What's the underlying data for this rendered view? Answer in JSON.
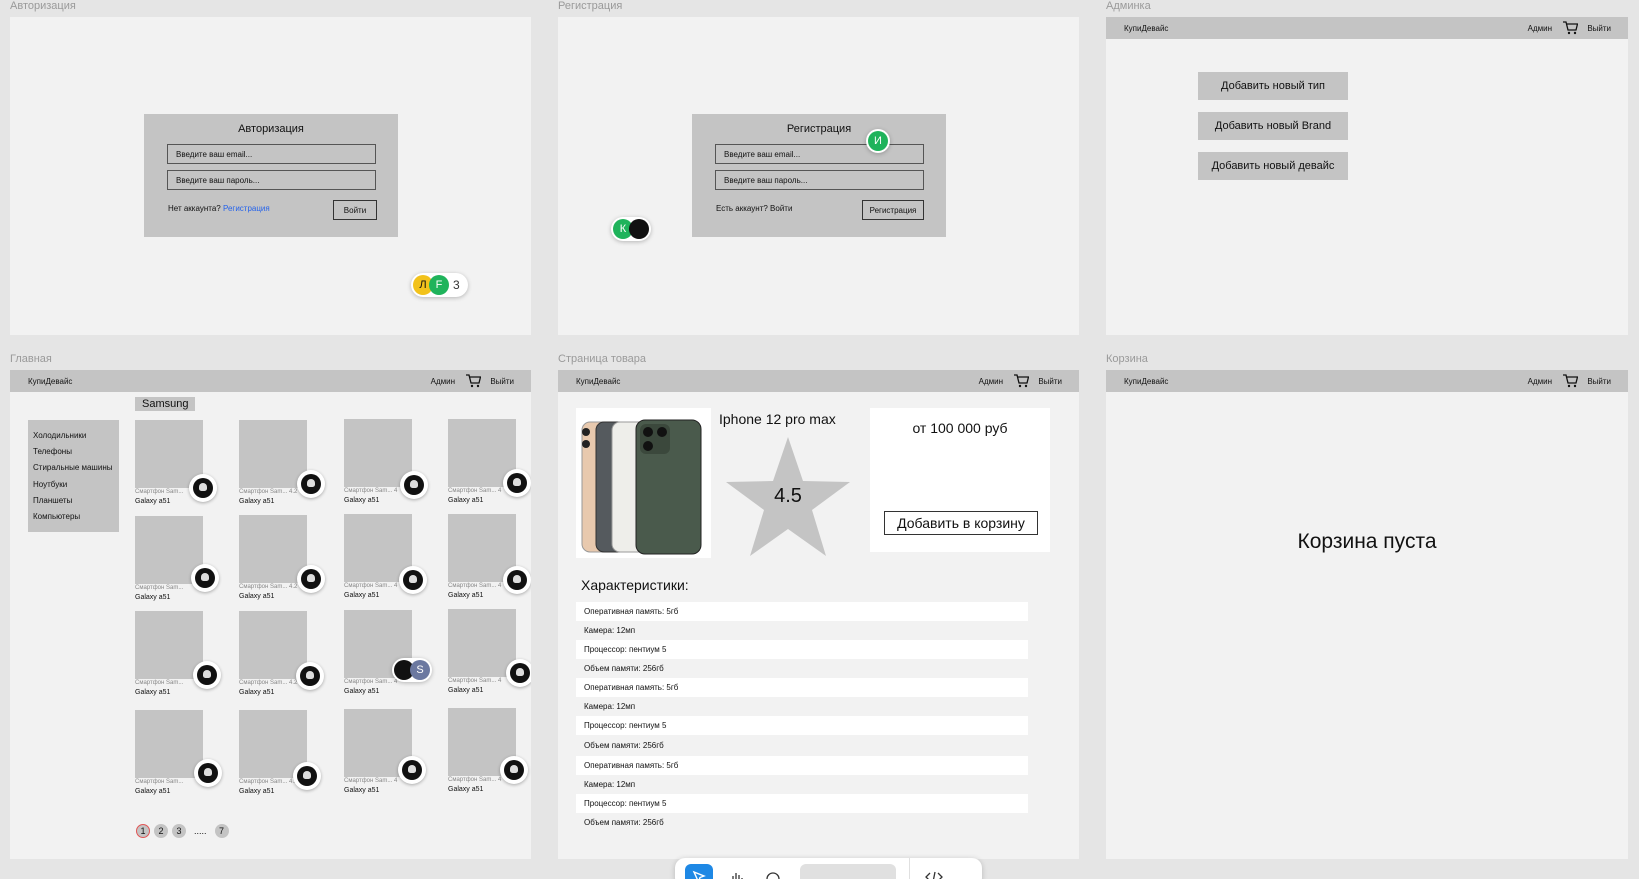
{
  "frames": {
    "auth": {
      "label": "Авторизация",
      "title": "Авторизация",
      "email_placeholder": "Введите ваш email...",
      "password_placeholder": "Введите ваш пароль...",
      "no_account": "Нет аккаунта?",
      "register_link": "Регистрация",
      "submit": "Войти",
      "presence": {
        "avatars": [
          "Л",
          "F"
        ],
        "count": "3"
      }
    },
    "register": {
      "label": "Регистрация",
      "title": "Регистрация",
      "email_placeholder": "Введите ваш email...",
      "password_placeholder": "Введите ваш пароль...",
      "have_account": "Есть аккаунт? Войти",
      "submit": "Регистрация",
      "cursor_avatar": "И",
      "presence_avatar": "К"
    },
    "admin": {
      "label": "Админка",
      "buttons": [
        "Добавить новый тип",
        "Добавить новый Brand",
        "Добавить новый девайс"
      ]
    },
    "main": {
      "label": "Главная",
      "categories": [
        "Холодильники",
        "Телефоны",
        "Стиральные машины",
        "Ноутбуки",
        "Планшеты",
        "Компьютеры"
      ],
      "brand_tag": "Samsung",
      "card_subtitles": [
        "Смартфон Sam...",
        "Смартфон Sam... 4.2",
        "Смартфон Sam... 4",
        "Смартфон Sam... 4"
      ],
      "card_name": "Galaxy a51",
      "pages": [
        "1",
        "2",
        "3",
        ".....",
        "7"
      ],
      "presence_avatar": "S"
    },
    "product": {
      "label": "Страница товара",
      "name": "Iphone 12 pro max",
      "rating": "4.5",
      "price": "от 100 000 руб",
      "add_to_cart": "Добавить в корзину",
      "specs_title": "Характеристики:",
      "specs": [
        "Оперативная память: 5гб",
        "Камера: 12мп",
        "Процессор: пентиум 5",
        "Объем памяти: 256гб",
        "Оперативная память: 5гб",
        "Камера: 12мп",
        "Процессор: пентиум 5",
        "Объем памяти: 256гб",
        "Оперативная память: 5гб",
        "Камера: 12мп",
        "Процессор: пентиум 5",
        "Объем памяти: 256гб"
      ]
    },
    "cart": {
      "label": "Корзина",
      "empty_text": "Корзина пуста"
    }
  },
  "navbar": {
    "brand": "КупиДевайс",
    "admin": "Админ",
    "logout": "Выйти"
  },
  "colors": {
    "canvas": "#e5e5e5",
    "frame": "#f2f2f2",
    "block_gray": "#c4c4c4",
    "link_blue": "#2563eb",
    "presence_green": "#1fb35b",
    "presence_yellow": "#f2c21b",
    "toolbar_accent": "#1e88e5"
  },
  "icons": [
    "cart-icon",
    "star-icon",
    "skull-avatar-icon",
    "cursor-icon",
    "hand-icon",
    "comment-icon",
    "code-icon"
  ]
}
